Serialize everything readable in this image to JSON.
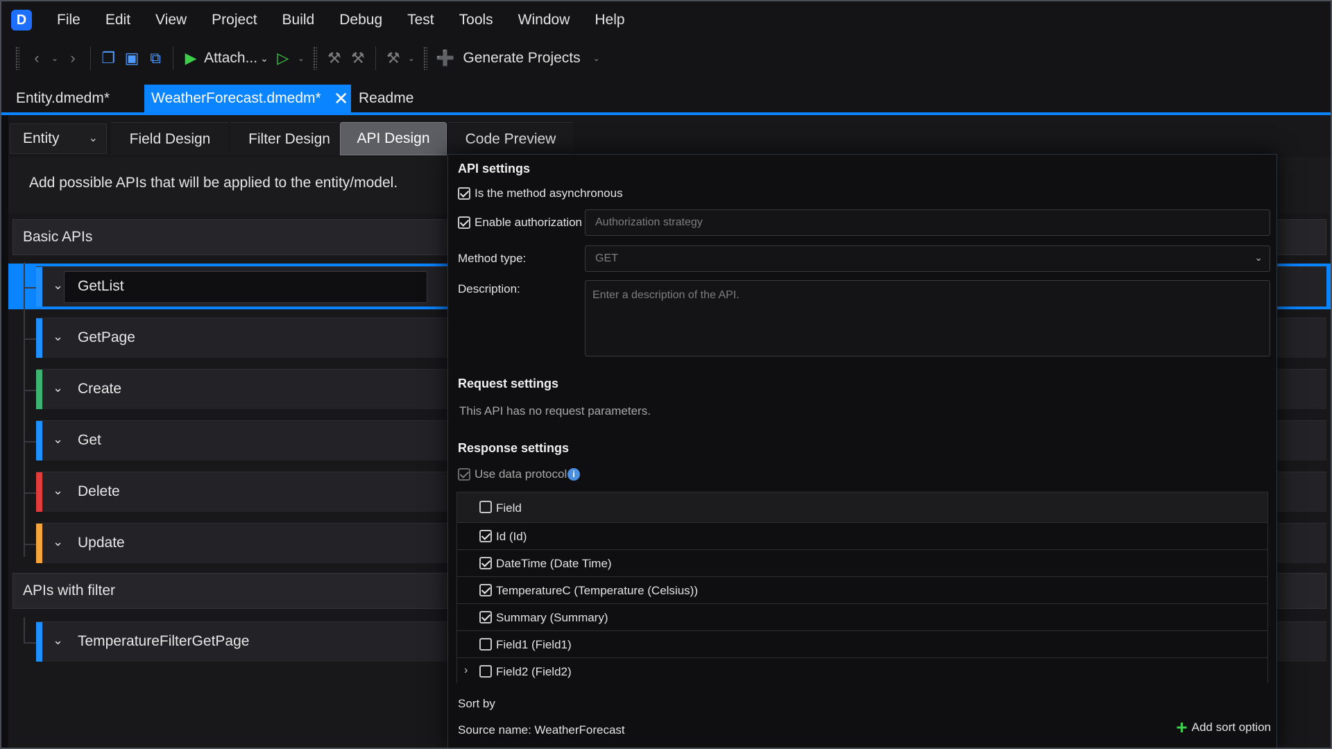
{
  "menu": [
    "File",
    "Edit",
    "View",
    "Project",
    "Build",
    "Debug",
    "Test",
    "Tools",
    "Window",
    "Help"
  ],
  "toolbar": {
    "attach_label": "Attach...",
    "generate_label": "Generate Projects"
  },
  "doc_tabs": [
    {
      "label": "Entity.dmedm*",
      "active": false
    },
    {
      "label": "WeatherForecast.dmedm*",
      "active": true
    },
    {
      "label": "Readme",
      "active": false
    }
  ],
  "design": {
    "entity_select": "Entity",
    "tabs": [
      "Field Design",
      "Filter Design",
      "API Design",
      "Code Preview"
    ],
    "active_tab": "API Design",
    "subtitle": "Add possible APIs that will be applied to the entity/model."
  },
  "api_groups": [
    {
      "title": "Basic APIs",
      "items": [
        {
          "name": "GetList",
          "color": "#1e90ff",
          "selected": true
        },
        {
          "name": "GetPage",
          "color": "#1e90ff"
        },
        {
          "name": "Create",
          "color": "#3cb371"
        },
        {
          "name": "Get",
          "color": "#1e90ff"
        },
        {
          "name": "Delete",
          "color": "#e03c3c"
        },
        {
          "name": "Update",
          "color": "#f5a53a"
        }
      ]
    },
    {
      "title": "APIs with filter",
      "items": [
        {
          "name": "TemperatureFilterGetPage",
          "color": "#1e90ff"
        }
      ]
    }
  ],
  "api_settings": {
    "title": "API settings",
    "async_label": "Is the method asynchronous",
    "auth_label": "Enable authorization",
    "auth_placeholder": "Authorization strategy",
    "method_label": "Method type:",
    "method_value": "GET",
    "desc_label": "Description:",
    "desc_placeholder": "Enter a description of the API."
  },
  "request_settings": {
    "title": "Request settings",
    "text": "This API has no request parameters."
  },
  "response_settings": {
    "title": "Response settings",
    "protocol_label": "Use data protocol",
    "field_header": "Field",
    "fields": [
      {
        "label": "Id (Id)",
        "checked": true
      },
      {
        "label": "DateTime (Date Time)",
        "checked": true
      },
      {
        "label": "TemperatureC (Temperature (Celsius))",
        "checked": true
      },
      {
        "label": "Summary (Summary)",
        "checked": true
      },
      {
        "label": "Field1 (Field1)",
        "checked": false
      },
      {
        "label": "Field2 (Field2)",
        "checked": false,
        "expandable": true
      }
    ],
    "sort_by_label": "Sort by",
    "source_name": "Source name: WeatherForecast",
    "add_sort_label": "Add sort option"
  },
  "colors": {
    "accent": "#0a84ff",
    "play": "#3ecf4a"
  }
}
